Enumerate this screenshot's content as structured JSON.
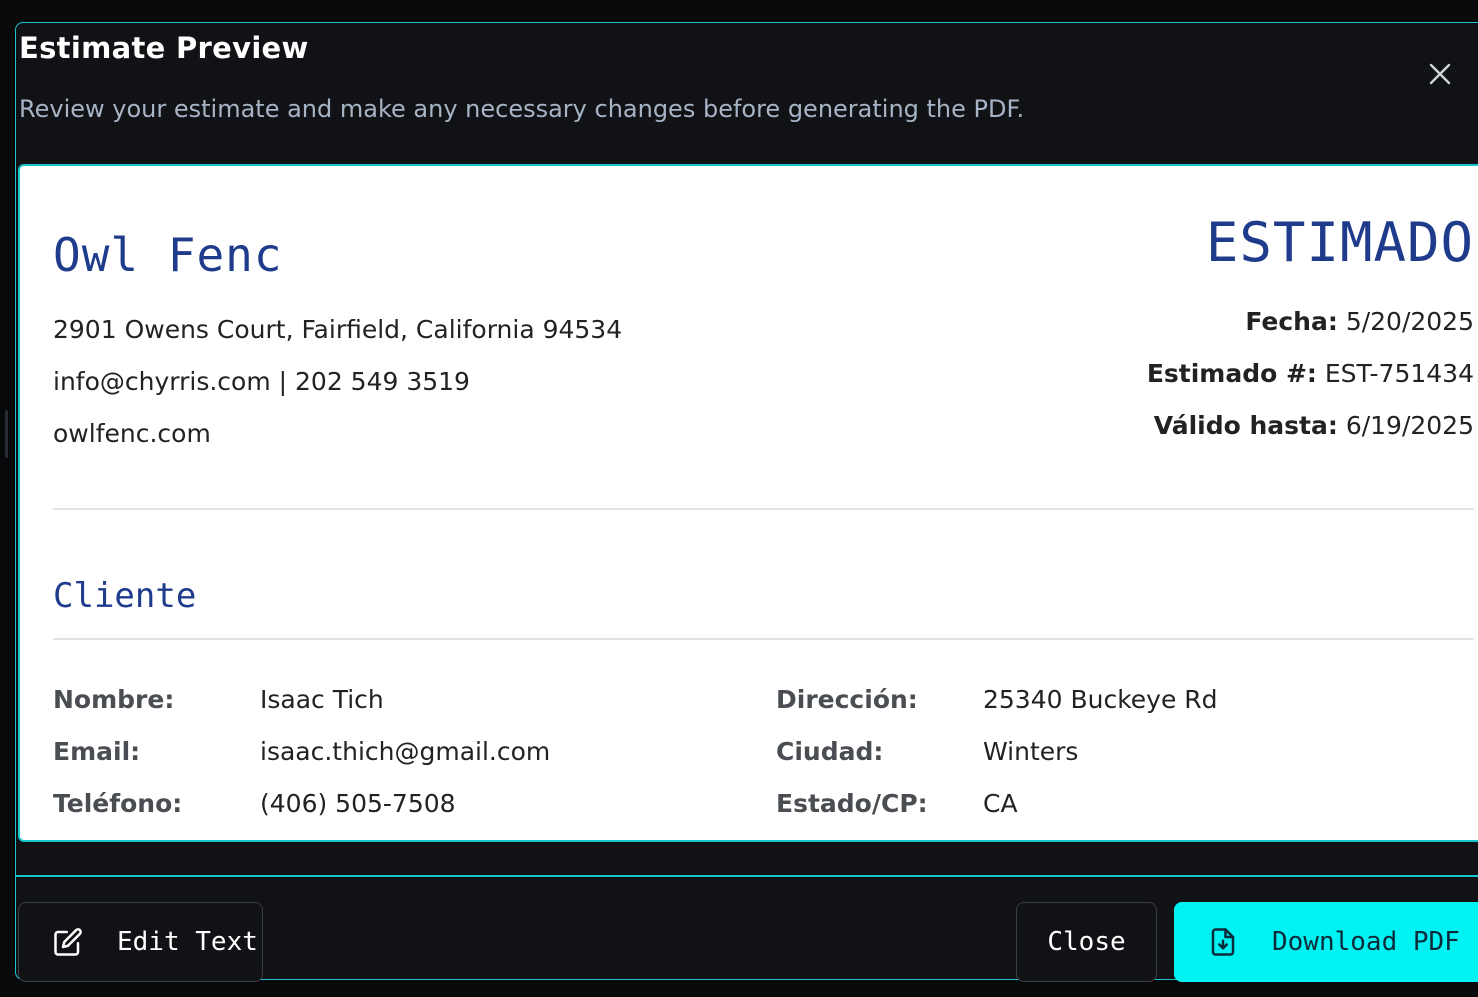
{
  "modal": {
    "title": "Estimate Preview",
    "description": "Review your estimate and make any necessary changes before generating the PDF.",
    "close_icon": "close-icon"
  },
  "company": {
    "name": "Owl Fenc",
    "address": "2901 Owens Court, Fairfield, California 94534",
    "contact": "info@chyrris.com | 202 549 3519",
    "website": "owlfenc.com"
  },
  "estimate": {
    "heading": "ESTIMADO",
    "date_label": "Fecha:",
    "date_value": "5/20/2025",
    "number_label": "Estimado #:",
    "number_value": "EST-751434",
    "valid_label": "Válido hasta:",
    "valid_value": "6/19/2025"
  },
  "client": {
    "section_title": "Cliente",
    "name_label": "Nombre:",
    "name_value": "Isaac Tich",
    "email_label": "Email:",
    "email_value": "isaac.thich@gmail.com",
    "phone_label": "Teléfono:",
    "phone_value": "(406) 505-7508",
    "address_label": "Dirección:",
    "address_value": "25340 Buckeye Rd",
    "city_label": "Ciudad:",
    "city_value": "Winters",
    "state_label": "Estado/CP:",
    "state_value": "CA"
  },
  "footer": {
    "edit_label": "Edit Text",
    "edit_icon": "edit-icon",
    "close_label": "Close",
    "download_label": "Download PDF",
    "download_icon": "file-download-icon"
  },
  "colors": {
    "accent": "#19c6cf",
    "download_button": "#00f2f2",
    "heading_blue": "#1f3b8c",
    "modal_bg": "#111215"
  }
}
